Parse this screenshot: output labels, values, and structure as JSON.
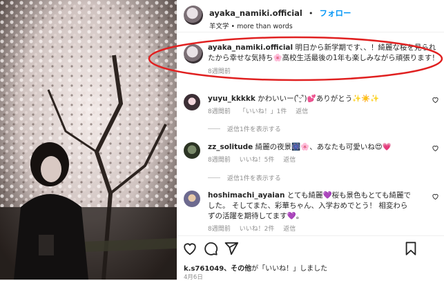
{
  "post": {
    "username": "ayaka_namiki.official",
    "follow_label": "フォロー",
    "dot": "•",
    "audio": "羊文学 • more than words"
  },
  "caption": {
    "username": "ayaka_namiki.official",
    "text": "明日から新学期です、、！綺麗な桜を見られたから幸せな気持ち🌸高校生活最後の1年も楽しみながら頑張ります！",
    "time": "8週間前"
  },
  "comments": [
    {
      "username": "yuyu_kkkkk",
      "text": "かわいいー(ՙ̑ᵕ̮ՙ̑)💕ありがとう✨☀️✨",
      "time": "8週間前",
      "likes": "「いいね！」1件",
      "reply": "返信",
      "view_replies": "返信1件を表示する"
    },
    {
      "username": "zz_solitude",
      "text": "綺麗の夜景🎆🌸、あなたも可愛いね😍💗",
      "time": "8週間前",
      "likes": "いいね！5件",
      "reply": "返信",
      "view_replies": "返信1件を表示する"
    },
    {
      "username": "hoshimachi_ayaian",
      "text": "とても綺麗💜桜も景色もとても綺麗でした。 そしてまた、彩華ちゃん、入学おめでとう！ 相変わらずの活躍を期待してます💜。",
      "time": "8週間前",
      "likes": "いいね！2件",
      "reply": "返信"
    }
  ],
  "footer": {
    "likes_user": "k.s761049",
    "likes_rest": "、その他",
    "likes_tail": "が「いいね！」しました",
    "date": "4月6日"
  },
  "icons": [
    "heart-icon",
    "comment-icon",
    "share-icon",
    "bookmark-icon"
  ],
  "colors": {
    "follow": "#0095f6",
    "highlight": "#e02020",
    "muted": "#8e8e8e"
  }
}
